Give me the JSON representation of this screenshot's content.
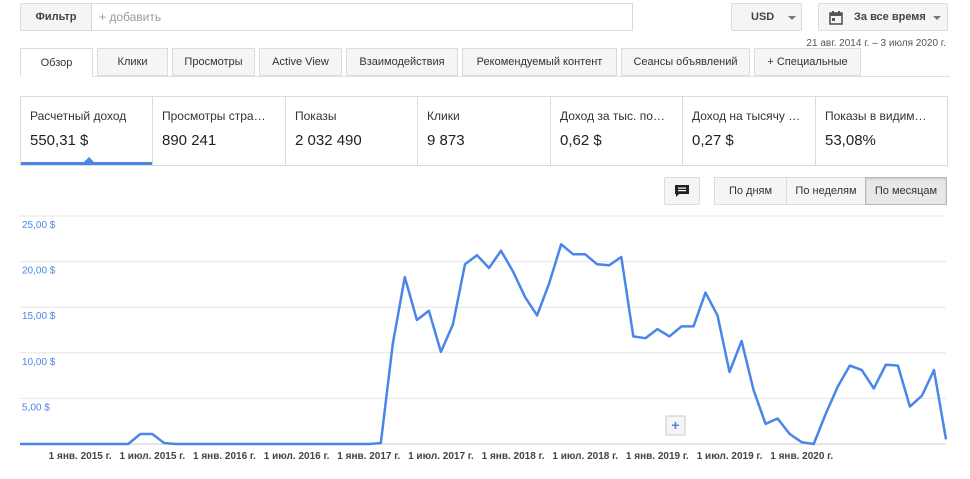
{
  "toolbar": {
    "filter_label": "Фильтр",
    "filter_placeholder": "+ добавить",
    "currency_label": "USD",
    "date_label": "За все время",
    "date_range": "21 авг. 2014 г. – 3 июля 2020 г."
  },
  "tabs": [
    {
      "label": "Обзор",
      "active": true
    },
    {
      "label": "Клики"
    },
    {
      "label": "Просмотры"
    },
    {
      "label": "Active View"
    },
    {
      "label": "Взаимодействия"
    },
    {
      "label": "Рекомендуемый контент"
    },
    {
      "label": "Сеансы объявлений"
    },
    {
      "label": "+ Специальные"
    }
  ],
  "metrics": [
    {
      "label": "Расчетный доход",
      "value": "550,31 $",
      "active": true
    },
    {
      "label": "Просмотры стра…",
      "value": "890 241"
    },
    {
      "label": "Показы",
      "value": "2 032 490"
    },
    {
      "label": "Клики",
      "value": "9 873"
    },
    {
      "label": "Доход за тыс. по…",
      "value": "0,62 $"
    },
    {
      "label": "Доход на тысячу …",
      "value": "0,27 $"
    },
    {
      "label": "Показы в видим…",
      "value": "53,08%"
    }
  ],
  "granularity": {
    "day_label": "По дням",
    "week_label": "По неделям",
    "month_label": "По месяцам",
    "active": "month"
  },
  "colors": {
    "line": "#4a86e8",
    "grid": "#e6e6e6",
    "axis_label": "#4a86e8"
  },
  "chart_data": {
    "type": "line",
    "y_tick_labels": [
      "5,00 $",
      "10,00 $",
      "15,00 $",
      "20,00 $",
      "25,00 $"
    ],
    "y_ticks": [
      5,
      10,
      15,
      20,
      25
    ],
    "ylim": [
      0,
      25
    ],
    "x_tick_labels": [
      "1 янв. 2015 г.",
      "1 июл. 2015 г.",
      "1 янв. 2016 г.",
      "1 июл. 2016 г.",
      "1 янв. 2017 г.",
      "1 июл. 2017 г.",
      "1 янв. 2018 г.",
      "1 июл. 2018 г.",
      "1 янв. 2019 г.",
      "1 июл. 2019 г.",
      "1 янв. 2020 г."
    ],
    "x_tick_months": [
      "2015-01",
      "2015-07",
      "2016-01",
      "2016-07",
      "2017-01",
      "2017-07",
      "2018-01",
      "2018-07",
      "2019-01",
      "2019-07",
      "2020-01"
    ],
    "x": [
      "2014-08",
      "2014-09",
      "2014-10",
      "2014-11",
      "2014-12",
      "2015-01",
      "2015-02",
      "2015-03",
      "2015-04",
      "2015-05",
      "2015-06",
      "2015-07",
      "2015-08",
      "2015-09",
      "2015-10",
      "2015-11",
      "2015-12",
      "2016-01",
      "2016-02",
      "2016-03",
      "2016-04",
      "2016-05",
      "2016-06",
      "2016-07",
      "2016-08",
      "2016-09",
      "2016-10",
      "2016-11",
      "2016-12",
      "2017-01",
      "2017-02",
      "2017-03",
      "2017-04",
      "2017-05",
      "2017-06",
      "2017-07",
      "2017-08",
      "2017-09",
      "2017-10",
      "2017-11",
      "2017-12",
      "2018-01",
      "2018-02",
      "2018-03",
      "2018-04",
      "2018-05",
      "2018-06",
      "2018-07",
      "2018-08",
      "2018-09",
      "2018-10",
      "2018-11",
      "2018-12",
      "2019-01",
      "2019-02",
      "2019-03",
      "2019-04",
      "2019-05",
      "2019-06",
      "2019-07",
      "2019-08",
      "2019-09",
      "2019-10",
      "2019-11",
      "2019-12",
      "2020-01",
      "2020-02",
      "2020-03",
      "2020-04",
      "2020-05",
      "2020-06",
      "2020-07"
    ],
    "values": [
      0,
      0,
      0,
      0,
      0,
      0,
      0,
      0,
      0,
      0,
      1.1,
      1.1,
      0.1,
      0,
      0,
      0,
      0,
      0,
      0,
      0,
      0,
      0,
      0,
      0,
      0,
      0,
      0,
      0,
      0,
      0,
      0.1,
      11,
      18.3,
      13.6,
      14.6,
      10.1,
      13.1,
      19.7,
      20.7,
      19.3,
      21.2,
      18.9,
      16.1,
      14.1,
      17.6,
      21.9,
      20.8,
      20.8,
      19.7,
      19.6,
      20.5,
      11.8,
      11.6,
      12.6,
      11.8,
      12.9,
      12.9,
      16.6,
      14.1,
      7.9,
      11.3,
      5.9,
      2.2,
      2.8,
      1.1,
      0.2,
      0,
      3.3,
      6.3,
      8.6,
      8.1,
      6.1,
      8.7,
      8.6,
      4.1,
      5.3,
      8.1,
      0.5
    ],
    "grid": true
  }
}
